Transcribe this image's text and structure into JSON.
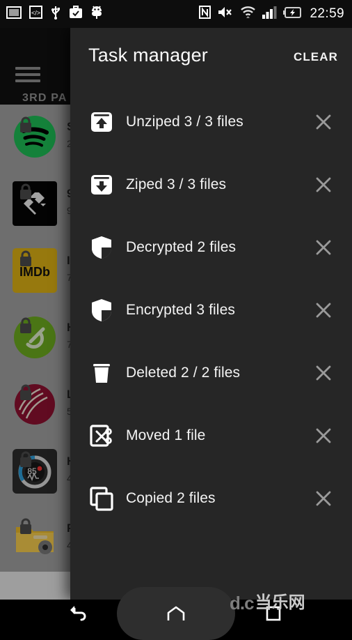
{
  "statusbar": {
    "time": "22:59",
    "left_icons": [
      {
        "name": "screenshot-icon"
      },
      {
        "name": "developer-code-icon"
      },
      {
        "name": "usb-icon"
      },
      {
        "name": "work-profile-icon"
      },
      {
        "name": "android-debug-icon"
      }
    ],
    "right_icons": [
      {
        "name": "nfc-icon"
      },
      {
        "name": "volume-mute-icon"
      },
      {
        "name": "wifi-icon"
      },
      {
        "name": "signal-bars-icon"
      },
      {
        "name": "battery-charging-icon"
      }
    ]
  },
  "background_app": {
    "menu_icon": "hamburger-icon",
    "section_label": "3RD PA",
    "apps": [
      {
        "title": "S",
        "subtitle": "2",
        "icon": "spotify-icon",
        "color": "#1db954",
        "locked": true
      },
      {
        "title": "9",
        "subtitle": "9",
        "icon": "ninegag-icon",
        "color": "#000000",
        "locked": true
      },
      {
        "title": "I",
        "subtitle": "7",
        "icon": "imdb-icon",
        "color": "#e2b616",
        "locked": true
      },
      {
        "title": "H",
        "subtitle": "7",
        "icon": "evernote-icon",
        "color": "#6aa81f",
        "locked": true
      },
      {
        "title": "L",
        "subtitle": "5",
        "icon": "cricket-ball-icon",
        "color": "#8b1130",
        "locked": true
      },
      {
        "title": "H",
        "subtitle": "4",
        "icon": "heart-rate-icon",
        "color": "#2b2b2b",
        "locked": true
      },
      {
        "title": "F",
        "subtitle": "4",
        "icon": "folder-settings-icon",
        "color": "#e8b827",
        "locked": true
      }
    ]
  },
  "drawer": {
    "title": "Task manager",
    "clear_label": "CLEAR",
    "tasks": [
      {
        "label": "Unziped 3 / 3 files",
        "icon": "unzip-icon",
        "close": "close-icon"
      },
      {
        "label": "Ziped 3 / 3 files",
        "icon": "zip-icon",
        "close": "close-icon"
      },
      {
        "label": "Decrypted 2 files",
        "icon": "shield-decrypt-icon",
        "close": "close-icon"
      },
      {
        "label": "Encrypted 3 files",
        "icon": "shield-encrypt-icon",
        "close": "close-icon"
      },
      {
        "label": "Deleted 2 / 2 files",
        "icon": "trash-icon",
        "close": "close-icon"
      },
      {
        "label": "Moved 1 file",
        "icon": "cut-move-icon",
        "close": "close-icon"
      },
      {
        "label": "Copied 2 files",
        "icon": "copy-icon",
        "close": "close-icon"
      }
    ]
  },
  "navbar": {
    "back": "back-icon",
    "home": "home-icon",
    "recent": "recents-icon"
  },
  "watermark": {
    "latin": "d.c",
    "chinese": "当乐网"
  },
  "colors": {
    "drawer_bg": "#262626",
    "appbar_bg": "#111111",
    "text_primary": "#f4f4f4",
    "text_muted": "#9a9a9a"
  }
}
